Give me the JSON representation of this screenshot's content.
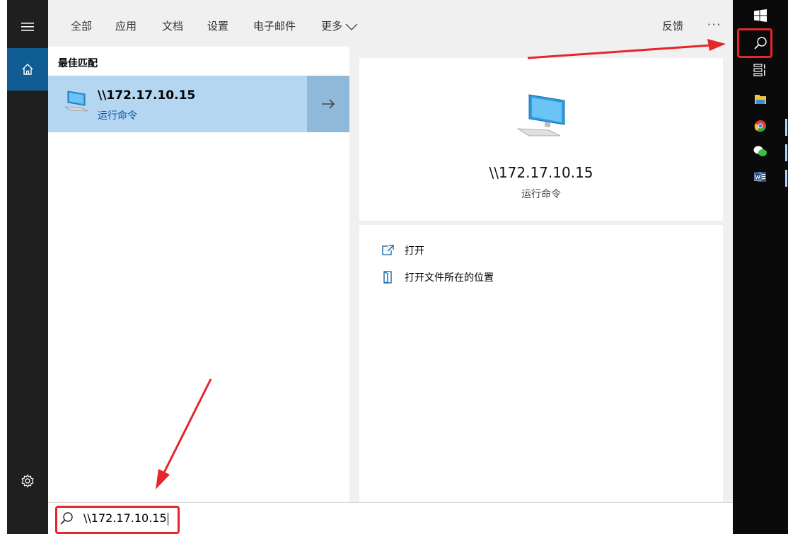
{
  "tabs": [
    "全部",
    "应用",
    "文档",
    "设置",
    "电子邮件",
    "更多"
  ],
  "feedback_label": "反馈",
  "more_options_label": "···",
  "best_match": {
    "section_title": "最佳匹配",
    "title": "\\\\172.17.10.15",
    "subtitle": "运行命令"
  },
  "preview": {
    "title": "\\\\172.17.10.15",
    "subtitle": "运行命令",
    "actions": [
      "打开",
      "打开文件所在的位置"
    ]
  },
  "search": {
    "query": "\\\\172.17.10.15"
  },
  "colors": {
    "selected_row": "#b4d6f1",
    "arrow_button": "#8fb8d9",
    "home_active": "#0f5d94",
    "annotation_red": "#e6262a",
    "taskbar": "#0a0a0a"
  },
  "icons": {
    "rail": [
      "hamburger-menu-icon",
      "home-icon",
      "gear-icon"
    ],
    "taskbar": [
      "windows-logo-icon",
      "search-icon",
      "task-view-icon",
      "file-explorer-icon",
      "chrome-icon",
      "wechat-icon",
      "word-icon"
    ]
  }
}
